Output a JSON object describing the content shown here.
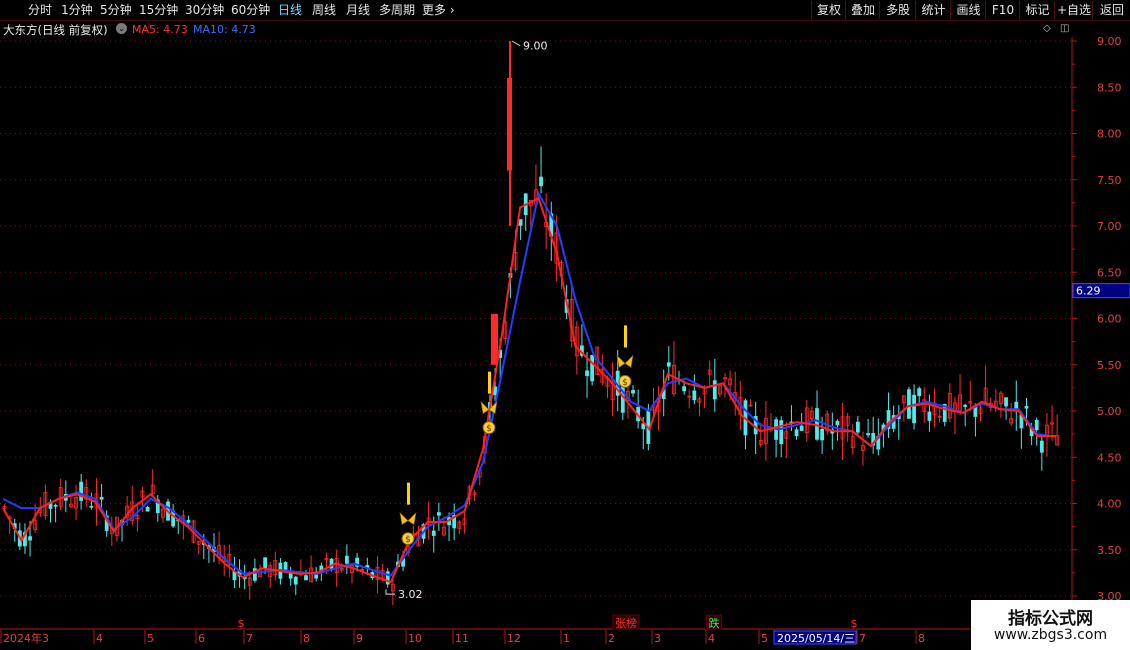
{
  "toolbar": {
    "periods": [
      "分时",
      "1分钟",
      "5分钟",
      "15分钟",
      "30分钟",
      "60分钟",
      "日线",
      "周线",
      "月线",
      "多周期",
      "更多"
    ],
    "active_period": "日线",
    "right_buttons": [
      "复权",
      "叠加",
      "多股",
      "统计",
      "画线",
      "F10",
      "标记",
      "+自选",
      "返回"
    ]
  },
  "stock": {
    "name": "大东方(日线 前复权)",
    "ma5_label": "MA5: 4.73",
    "ma10_label": "MA10: 4.73"
  },
  "colors": {
    "up": "#ff2a2a",
    "down": "#50e8e8",
    "ma5": "#ff2020",
    "ma10": "#2040ff",
    "grid": "#7a1010",
    "axis": "#b01818",
    "signal": "#ffd700"
  },
  "chart_data": {
    "type": "candlestick",
    "y_axis_ticks": [
      3.0,
      3.5,
      4.0,
      4.5,
      5.0,
      5.5,
      6.0,
      6.5,
      7.0,
      7.5,
      8.0,
      8.5,
      9.0
    ],
    "ylim": [
      2.8,
      9.1
    ],
    "current_price_label": "6.29",
    "high_annotation": "9.00",
    "low_annotation": "3.02",
    "x_labels": [
      "2024年3",
      "4",
      "5",
      "6",
      "7",
      "8",
      "9",
      "10",
      "11",
      "12",
      "1",
      "2",
      "3",
      "4",
      "5",
      "2025/05/14/三",
      "7",
      "8"
    ],
    "event_markers": [
      {
        "text": "$",
        "color": "#ff3030"
      },
      {
        "text": "张榜",
        "color": "#ff3030"
      },
      {
        "text": "跌",
        "color": "#30ff30"
      },
      {
        "text": "$",
        "color": "#ff3030"
      }
    ],
    "ma10": [
      4.05,
      3.95,
      3.95,
      4.05,
      4.12,
      4.05,
      3.72,
      3.85,
      4.05,
      3.95,
      3.78,
      3.6,
      3.4,
      3.24,
      3.26,
      3.28,
      3.26,
      3.24,
      3.3,
      3.35,
      3.28,
      3.22,
      3.5,
      3.75,
      3.85,
      3.98,
      4.45,
      5.4,
      6.4,
      7.35,
      7.0,
      6.2,
      5.6,
      5.35,
      5.1,
      5.0,
      5.3,
      5.35,
      5.25,
      5.3,
      5.05,
      4.85,
      4.8,
      4.85,
      4.9,
      4.82,
      4.78,
      4.62,
      4.85,
      5.05,
      5.1,
      5.05,
      4.98,
      5.08,
      5.02,
      5.02,
      4.75,
      4.72
    ],
    "ma5": [
      3.95,
      3.6,
      3.95,
      4.05,
      4.1,
      4.02,
      3.7,
      3.95,
      4.1,
      3.9,
      3.75,
      3.55,
      3.35,
      3.2,
      3.3,
      3.27,
      3.24,
      3.25,
      3.35,
      3.3,
      3.22,
      3.15,
      3.6,
      3.8,
      3.8,
      3.92,
      4.6,
      5.8,
      7.2,
      7.3,
      6.7,
      5.7,
      5.5,
      5.3,
      5.05,
      4.8,
      5.4,
      5.3,
      5.25,
      5.3,
      4.95,
      4.78,
      4.83,
      4.88,
      4.85,
      4.78,
      4.78,
      4.62,
      4.88,
      5.05,
      5.08,
      5.02,
      4.98,
      5.1,
      5.02,
      5.0,
      4.73,
      4.73
    ],
    "signals": [
      {
        "price": 3.62
      },
      {
        "price": 4.82
      },
      {
        "price": 5.32
      }
    ]
  },
  "watermark": {
    "line1": "指标公式网",
    "line2": "www.zbgs3.com"
  }
}
